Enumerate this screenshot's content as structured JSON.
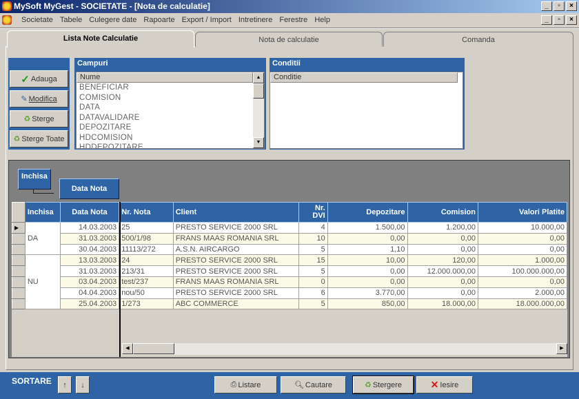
{
  "window": {
    "title": "MySoft MyGest  - SOCIETATE - [Nota de calculatie]",
    "controls": [
      "_",
      "▫",
      "×"
    ]
  },
  "menu": [
    "Societate",
    "Tabele",
    "Culegere date",
    "Rapoarte",
    "Export / Import",
    "Intretinere",
    "Ferestre",
    "Help"
  ],
  "tabs": [
    {
      "label": "Lista Note Calculatie",
      "active": true
    },
    {
      "label": "Nota de calculatie"
    },
    {
      "label": "Comanda"
    }
  ],
  "actions": {
    "add": "Adauga",
    "edit": "Modifica",
    "delete": "Sterge",
    "delete_all": "Sterge Toate"
  },
  "campuri": {
    "title": "Campuri",
    "column": "Nume",
    "items": [
      "BENEFICIAR",
      "COMISION",
      "DATA",
      "DATAVALIDARE",
      "DEPOZITARE",
      "HDCOMISION",
      "HDDEPOZITARE"
    ]
  },
  "conditii": {
    "title": "Conditii",
    "column": "Conditie"
  },
  "grouping": [
    "Inchisa",
    "Data Nota"
  ],
  "grid": {
    "columns": [
      "Inchisa",
      "Data Nota",
      "Nr. Nota",
      "Client",
      "Nr. DVI",
      "Depozitare",
      "Comision",
      "Valori Platite"
    ],
    "groups": [
      {
        "label": "DA",
        "rows": 3
      },
      {
        "label": "NU",
        "rows": 5
      }
    ],
    "rows": [
      [
        "14.03.2003",
        "25",
        "PRESTO SERVICE  2000 SRL",
        "4",
        "1.500,00",
        "1.200,00",
        "10.000,00"
      ],
      [
        "31.03.2003",
        "500/1/98",
        "FRANS MAAS ROMANIA SRL",
        "10",
        "0,00",
        "0,00",
        "0,00"
      ],
      [
        "30.04.2003",
        "11113/272",
        "A.S.N. AIRCARGO",
        "5",
        "1,10",
        "0,00",
        "0,00"
      ],
      [
        "13.03.2003",
        "24",
        "PRESTO SERVICE  2000 SRL",
        "15",
        "10,00",
        "120,00",
        "1.000,00"
      ],
      [
        "31.03.2003",
        "213/31",
        "PRESTO SERVICE  2000 SRL",
        "5",
        "0,00",
        "12.000.000,00",
        "100.000.000,00"
      ],
      [
        "03.04.2003",
        "test/237",
        "FRANS MAAS ROMANIA SRL",
        "0",
        "0,00",
        "0,00",
        "0,00"
      ],
      [
        "04.04.2003",
        "nou/50",
        "PRESTO SERVICE  2000 SRL",
        "6",
        "3.770,00",
        "0,00",
        "2.000,00"
      ],
      [
        "25.04.2003",
        "1/273",
        "ABC COMMERCE",
        "5",
        "850,00",
        "18.000,00",
        "18.000.000,00"
      ]
    ]
  },
  "footer": {
    "sort_label": "SORTARE",
    "sort_up": "↑",
    "sort_down": "↓",
    "print": "Listare",
    "search": "Cautare",
    "delete": "Stergere",
    "exit": "Iesire"
  }
}
